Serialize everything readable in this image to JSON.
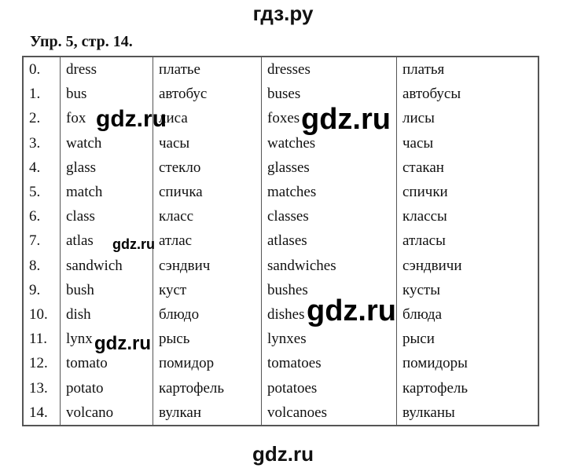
{
  "header": {
    "site": "гдз.ру"
  },
  "exercise_title": "Упр. 5, стр. 14.",
  "rows": [
    [
      "0.",
      "dress",
      "платье",
      "dresses",
      "платья"
    ],
    [
      "1.",
      "bus",
      "автобус",
      "buses",
      "автобусы"
    ],
    [
      "2.",
      "fox",
      "лиса",
      "foxes",
      "лисы"
    ],
    [
      "3.",
      "watch",
      "часы",
      "watches",
      "часы"
    ],
    [
      "4.",
      "glass",
      "стекло",
      "glasses",
      "стакан"
    ],
    [
      "5.",
      "match",
      "спичка",
      "matches",
      "спички"
    ],
    [
      "6.",
      "class",
      "класс",
      "classes",
      "классы"
    ],
    [
      "7.",
      "atlas",
      "атлас",
      "atlases",
      "атласы"
    ],
    [
      "8.",
      "sandwich",
      "сэндвич",
      "sandwiches",
      "сэндвичи"
    ],
    [
      "9.",
      "bush",
      "куст",
      "bushes",
      "кусты"
    ],
    [
      "10.",
      "dish",
      "блюдо",
      "dishes",
      "блюда"
    ],
    [
      "11.",
      "lynx",
      "рысь",
      "lynxes",
      "рыси"
    ],
    [
      "12.",
      "tomato",
      "помидор",
      "tomatoes",
      "помидоры"
    ],
    [
      "13.",
      "potato",
      "картофель",
      "potatoes",
      "картофель"
    ],
    [
      "14.",
      "volcano",
      "вулкан",
      "volcanoes",
      "вулканы"
    ]
  ],
  "watermark": "gdz.ru",
  "footer": {
    "site": "gdz.ru"
  }
}
